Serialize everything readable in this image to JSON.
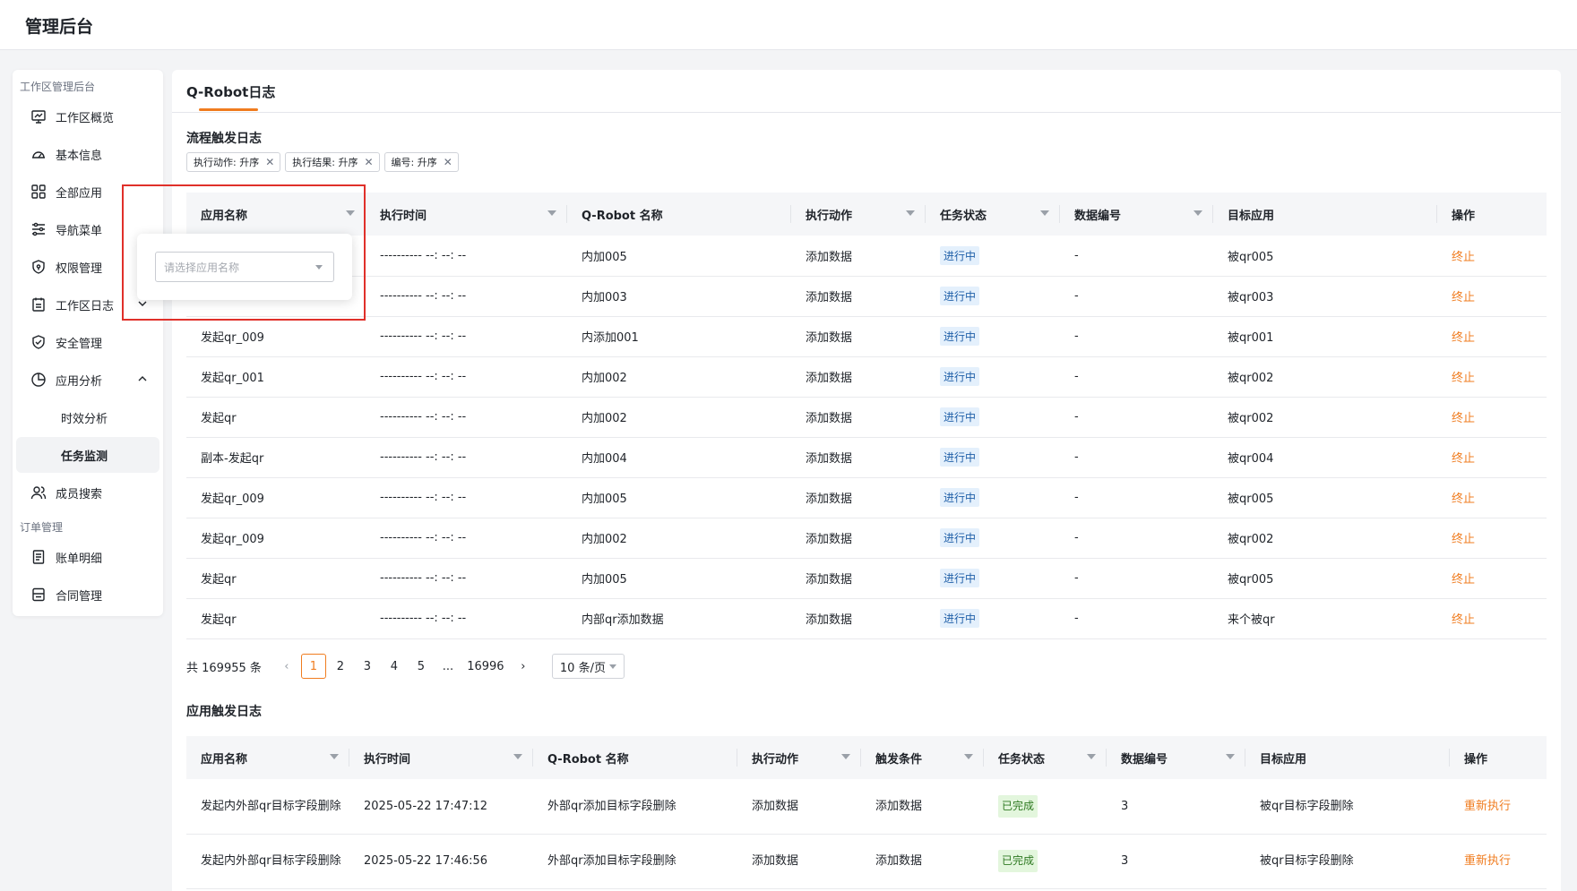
{
  "header": {
    "title": "管理后台"
  },
  "sidebar": {
    "group1": "工作区管理后台",
    "items": [
      {
        "label": "工作区概览",
        "icon": "monitor-icon"
      },
      {
        "label": "基本信息",
        "icon": "gauge-icon"
      },
      {
        "label": "全部应用",
        "icon": "grid-icon"
      },
      {
        "label": "导航菜单",
        "icon": "sliders-icon"
      },
      {
        "label": "权限管理",
        "icon": "shield-lock-icon"
      },
      {
        "label": "工作区日志",
        "icon": "calendar-icon"
      },
      {
        "label": "安全管理",
        "icon": "shield-check-icon"
      },
      {
        "label": "应用分析",
        "icon": "pie-chart-icon"
      }
    ],
    "sub_items": [
      {
        "label": "时效分析"
      },
      {
        "label": "任务监测"
      }
    ],
    "member_search": "成员搜索",
    "group2": "订单管理",
    "items2": [
      {
        "label": "账单明细",
        "icon": "receipt-icon"
      },
      {
        "label": "合同管理",
        "icon": "contract-icon"
      }
    ]
  },
  "tab": {
    "label": "Q-Robot日志"
  },
  "flow_log": {
    "title": "流程触发日志",
    "chips": [
      "执行动作: 升序",
      "执行结果: 升序",
      "编号: 升序"
    ],
    "columns": [
      "应用名称",
      "执行时间",
      "Q-Robot 名称",
      "执行动作",
      "任务状态",
      "数据编号",
      "目标应用",
      "操作"
    ],
    "rows": [
      [
        "",
        "---------- --: --: --",
        "内加005",
        "添加数据",
        "进行中",
        "-",
        "被qr005",
        "终止"
      ],
      [
        "",
        "---------- --: --: --",
        "内加003",
        "添加数据",
        "进行中",
        "-",
        "被qr003",
        "终止"
      ],
      [
        "发起qr_009",
        "---------- --: --: --",
        "内添加001",
        "添加数据",
        "进行中",
        "-",
        "被qr001",
        "终止"
      ],
      [
        "发起qr_001",
        "---------- --: --: --",
        "内加002",
        "添加数据",
        "进行中",
        "-",
        "被qr002",
        "终止"
      ],
      [
        "发起qr",
        "---------- --: --: --",
        "内加002",
        "添加数据",
        "进行中",
        "-",
        "被qr002",
        "终止"
      ],
      [
        "副本-发起qr",
        "---------- --: --: --",
        "内加004",
        "添加数据",
        "进行中",
        "-",
        "被qr004",
        "终止"
      ],
      [
        "发起qr_009",
        "---------- --: --: --",
        "内加005",
        "添加数据",
        "进行中",
        "-",
        "被qr005",
        "终止"
      ],
      [
        "发起qr_009",
        "---------- --: --: --",
        "内加002",
        "添加数据",
        "进行中",
        "-",
        "被qr002",
        "终止"
      ],
      [
        "发起qr",
        "---------- --: --: --",
        "内加005",
        "添加数据",
        "进行中",
        "-",
        "被qr005",
        "终止"
      ],
      [
        "发起qr",
        "---------- --: --: --",
        "内部qr添加数据",
        "添加数据",
        "进行中",
        "-",
        "来个被qr",
        "终止"
      ]
    ]
  },
  "pager": {
    "total": "共 169955 条",
    "pages": [
      "1",
      "2",
      "3",
      "4",
      "5",
      "...",
      "16996"
    ],
    "current": "1",
    "prev": "‹",
    "next": "›",
    "page_size": "10 条/页"
  },
  "app_log": {
    "title": "应用触发日志",
    "columns": [
      "应用名称",
      "执行时间",
      "Q-Robot 名称",
      "执行动作",
      "触发条件",
      "任务状态",
      "数据编号",
      "目标应用",
      "操作"
    ],
    "rows": [
      [
        "发起内外部qr目标字段删除",
        "2025-05-22 17:47:12",
        "外部qr添加目标字段删除",
        "添加数据",
        "添加数据",
        "已完成",
        "3",
        "被qr目标字段删除",
        "重新执行"
      ],
      [
        "发起内外部qr目标字段删除",
        "2025-05-22 17:46:56",
        "外部qr添加目标字段删除",
        "添加数据",
        "添加数据",
        "已完成",
        "3",
        "被qr目标字段删除",
        "重新执行"
      ]
    ]
  },
  "filter_popover": {
    "placeholder": "请选择应用名称"
  },
  "colors": {
    "accent": "#f07c1f",
    "highlight": "#e0302a",
    "running_bg": "#e4f0fc",
    "done_bg": "#e3f6dd"
  }
}
